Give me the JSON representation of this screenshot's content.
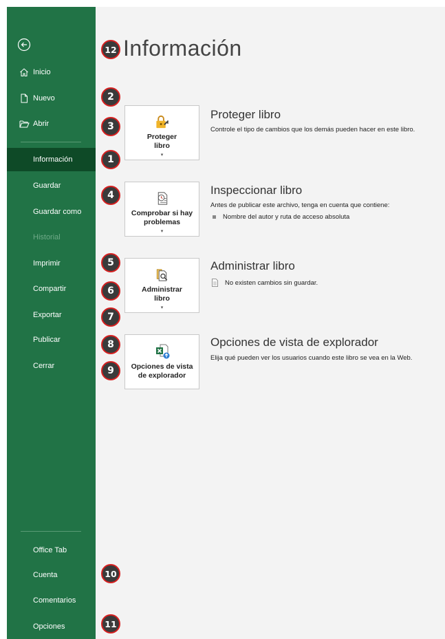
{
  "sidebar": {
    "top_items": [
      {
        "label": "Inicio",
        "icon": "home-icon"
      },
      {
        "label": "Nuevo",
        "icon": "new-document-icon"
      },
      {
        "label": "Abrir",
        "icon": "open-folder-icon"
      }
    ],
    "items": [
      {
        "label": "Información",
        "state": "selected"
      },
      {
        "label": "Guardar",
        "state": "normal"
      },
      {
        "label": "Guardar como",
        "state": "normal"
      },
      {
        "label": "Historial",
        "state": "disabled"
      },
      {
        "label": "Imprimir",
        "state": "normal"
      },
      {
        "label": "Compartir",
        "state": "normal"
      },
      {
        "label": "Exportar",
        "state": "normal"
      },
      {
        "label": "Publicar",
        "state": "normal"
      },
      {
        "label": "Cerrar",
        "state": "normal"
      }
    ],
    "bottom_items": [
      {
        "label": "Office Tab"
      },
      {
        "label": "Cuenta"
      },
      {
        "label": "Comentarios"
      },
      {
        "label": "Opciones"
      }
    ]
  },
  "main": {
    "title": "Información",
    "sections": [
      {
        "button_line1": "Proteger",
        "button_line2": "libro",
        "caret": "▾",
        "icon": "lock-key-icon",
        "title": "Proteger libro",
        "description": "Controle el tipo de cambios que los demás pueden hacer en este libro."
      },
      {
        "button_line1": "Comprobar si hay",
        "button_line2": "problemas",
        "caret": "▾",
        "icon": "inspect-document-icon",
        "title": "Inspeccionar libro",
        "description": "Antes de publicar este archivo, tenga en cuenta que contiene:",
        "bullet": "Nombre del autor y ruta de acceso absoluta"
      },
      {
        "button_line1": "Administrar",
        "button_line2": "libro",
        "caret": "▾",
        "icon": "manage-workbook-icon",
        "title": "Administrar libro",
        "bullet": "No existen cambios sin guardar."
      },
      {
        "button_line1": "Opciones de vista",
        "button_line2": "de explorador",
        "caret": "",
        "icon": "browser-view-options-icon",
        "title": "Opciones de vista de explorador",
        "description": "Elija qué pueden ver los usuarios cuando este libro se vea en la Web."
      }
    ]
  },
  "badges": [
    "12",
    "2",
    "3",
    "1",
    "4",
    "5",
    "6",
    "7",
    "8",
    "9",
    "10",
    "11"
  ],
  "colors": {
    "sidebar": "#217346",
    "sidebar_selected": "#0e4a27",
    "badge_fill": "#3a3a3a",
    "badge_border": "#d62020",
    "content_bg": "#f3f3f3"
  }
}
